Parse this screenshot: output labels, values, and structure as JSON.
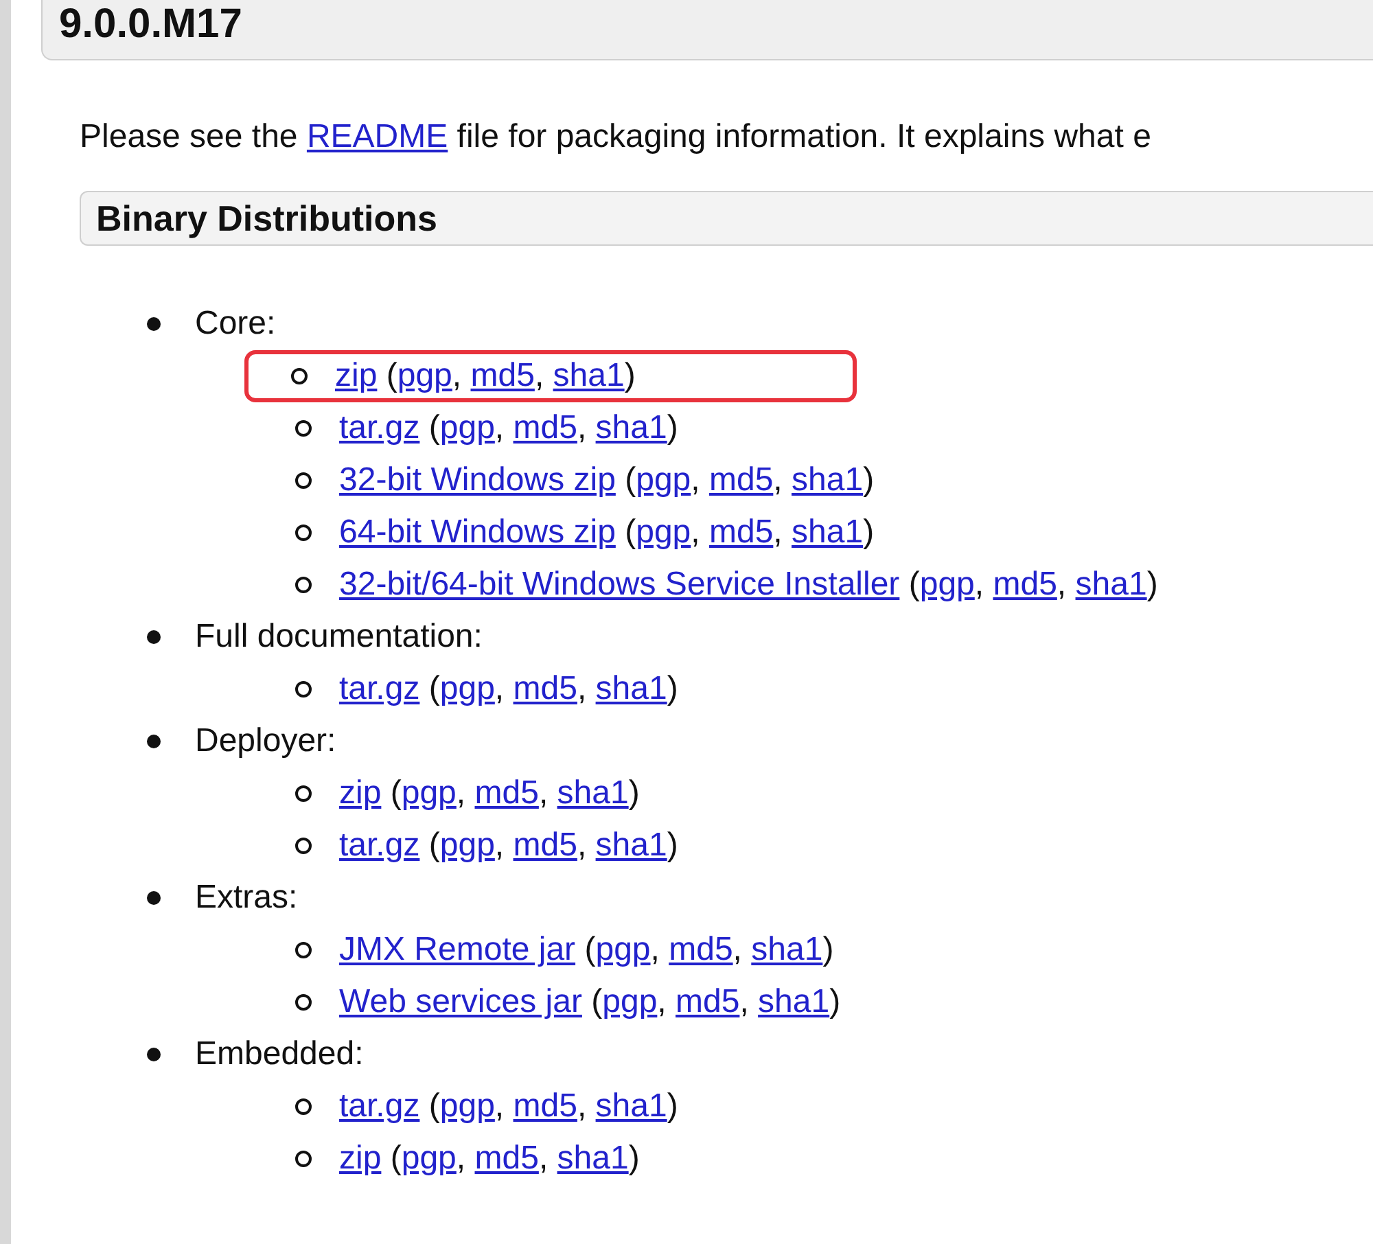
{
  "version_heading": "9.0.0.M17",
  "intro": [
    {
      "kind": "text",
      "text": "Please see the "
    },
    {
      "kind": "link",
      "text": "README"
    },
    {
      "kind": "text",
      "text": " file for packaging information. It explains what e"
    }
  ],
  "section_heading": "Binary Distributions",
  "groups": [
    {
      "label": "Core:",
      "items": [
        {
          "highlighted": true,
          "parts": [
            {
              "kind": "link",
              "text": "zip"
            },
            {
              "kind": "text",
              "text": " ("
            },
            {
              "kind": "link",
              "text": "pgp"
            },
            {
              "kind": "text",
              "text": ", "
            },
            {
              "kind": "link",
              "text": "md5"
            },
            {
              "kind": "text",
              "text": ", "
            },
            {
              "kind": "link",
              "text": "sha1"
            },
            {
              "kind": "text",
              "text": ")"
            }
          ]
        },
        {
          "highlighted": false,
          "parts": [
            {
              "kind": "link",
              "text": "tar.gz"
            },
            {
              "kind": "text",
              "text": " ("
            },
            {
              "kind": "link",
              "text": "pgp"
            },
            {
              "kind": "text",
              "text": ", "
            },
            {
              "kind": "link",
              "text": "md5"
            },
            {
              "kind": "text",
              "text": ", "
            },
            {
              "kind": "link",
              "text": "sha1"
            },
            {
              "kind": "text",
              "text": ")"
            }
          ]
        },
        {
          "highlighted": false,
          "parts": [
            {
              "kind": "link",
              "text": "32-bit Windows zip"
            },
            {
              "kind": "text",
              "text": " ("
            },
            {
              "kind": "link",
              "text": "pgp"
            },
            {
              "kind": "text",
              "text": ", "
            },
            {
              "kind": "link",
              "text": "md5"
            },
            {
              "kind": "text",
              "text": ", "
            },
            {
              "kind": "link",
              "text": "sha1"
            },
            {
              "kind": "text",
              "text": ")"
            }
          ]
        },
        {
          "highlighted": false,
          "parts": [
            {
              "kind": "link",
              "text": "64-bit Windows zip"
            },
            {
              "kind": "text",
              "text": " ("
            },
            {
              "kind": "link",
              "text": "pgp"
            },
            {
              "kind": "text",
              "text": ", "
            },
            {
              "kind": "link",
              "text": "md5"
            },
            {
              "kind": "text",
              "text": ", "
            },
            {
              "kind": "link",
              "text": "sha1"
            },
            {
              "kind": "text",
              "text": ")"
            }
          ]
        },
        {
          "highlighted": false,
          "parts": [
            {
              "kind": "link",
              "text": "32-bit/64-bit Windows Service Installer"
            },
            {
              "kind": "text",
              "text": " ("
            },
            {
              "kind": "link",
              "text": "pgp"
            },
            {
              "kind": "text",
              "text": ", "
            },
            {
              "kind": "link",
              "text": "md5"
            },
            {
              "kind": "text",
              "text": ", "
            },
            {
              "kind": "link",
              "text": "sha1"
            },
            {
              "kind": "text",
              "text": ")"
            }
          ]
        }
      ]
    },
    {
      "label": "Full documentation:",
      "items": [
        {
          "highlighted": false,
          "parts": [
            {
              "kind": "link",
              "text": "tar.gz"
            },
            {
              "kind": "text",
              "text": " ("
            },
            {
              "kind": "link",
              "text": "pgp"
            },
            {
              "kind": "text",
              "text": ", "
            },
            {
              "kind": "link",
              "text": "md5"
            },
            {
              "kind": "text",
              "text": ", "
            },
            {
              "kind": "link",
              "text": "sha1"
            },
            {
              "kind": "text",
              "text": ")"
            }
          ]
        }
      ]
    },
    {
      "label": "Deployer:",
      "items": [
        {
          "highlighted": false,
          "parts": [
            {
              "kind": "link",
              "text": "zip"
            },
            {
              "kind": "text",
              "text": " ("
            },
            {
              "kind": "link",
              "text": "pgp"
            },
            {
              "kind": "text",
              "text": ", "
            },
            {
              "kind": "link",
              "text": "md5"
            },
            {
              "kind": "text",
              "text": ", "
            },
            {
              "kind": "link",
              "text": "sha1"
            },
            {
              "kind": "text",
              "text": ")"
            }
          ]
        },
        {
          "highlighted": false,
          "parts": [
            {
              "kind": "link",
              "text": "tar.gz"
            },
            {
              "kind": "text",
              "text": " ("
            },
            {
              "kind": "link",
              "text": "pgp"
            },
            {
              "kind": "text",
              "text": ", "
            },
            {
              "kind": "link",
              "text": "md5"
            },
            {
              "kind": "text",
              "text": ", "
            },
            {
              "kind": "link",
              "text": "sha1"
            },
            {
              "kind": "text",
              "text": ")"
            }
          ]
        }
      ]
    },
    {
      "label": "Extras:",
      "items": [
        {
          "highlighted": false,
          "parts": [
            {
              "kind": "link",
              "text": "JMX Remote jar"
            },
            {
              "kind": "text",
              "text": " ("
            },
            {
              "kind": "link",
              "text": "pgp"
            },
            {
              "kind": "text",
              "text": ", "
            },
            {
              "kind": "link",
              "text": "md5"
            },
            {
              "kind": "text",
              "text": ", "
            },
            {
              "kind": "link",
              "text": "sha1"
            },
            {
              "kind": "text",
              "text": ")"
            }
          ]
        },
        {
          "highlighted": false,
          "parts": [
            {
              "kind": "link",
              "text": "Web services jar"
            },
            {
              "kind": "text",
              "text": " ("
            },
            {
              "kind": "link",
              "text": "pgp"
            },
            {
              "kind": "text",
              "text": ", "
            },
            {
              "kind": "link",
              "text": "md5"
            },
            {
              "kind": "text",
              "text": ", "
            },
            {
              "kind": "link",
              "text": "sha1"
            },
            {
              "kind": "text",
              "text": ")"
            }
          ]
        }
      ]
    },
    {
      "label": "Embedded:",
      "items": [
        {
          "highlighted": false,
          "parts": [
            {
              "kind": "link",
              "text": "tar.gz"
            },
            {
              "kind": "text",
              "text": " ("
            },
            {
              "kind": "link",
              "text": "pgp"
            },
            {
              "kind": "text",
              "text": ", "
            },
            {
              "kind": "link",
              "text": "md5"
            },
            {
              "kind": "text",
              "text": ", "
            },
            {
              "kind": "link",
              "text": "sha1"
            },
            {
              "kind": "text",
              "text": ")"
            }
          ]
        },
        {
          "highlighted": false,
          "parts": [
            {
              "kind": "link",
              "text": "zip"
            },
            {
              "kind": "text",
              "text": " ("
            },
            {
              "kind": "link",
              "text": "pgp"
            },
            {
              "kind": "text",
              "text": ", "
            },
            {
              "kind": "link",
              "text": "md5"
            },
            {
              "kind": "text",
              "text": ", "
            },
            {
              "kind": "link",
              "text": "sha1"
            },
            {
              "kind": "text",
              "text": ")"
            }
          ]
        }
      ]
    }
  ]
}
